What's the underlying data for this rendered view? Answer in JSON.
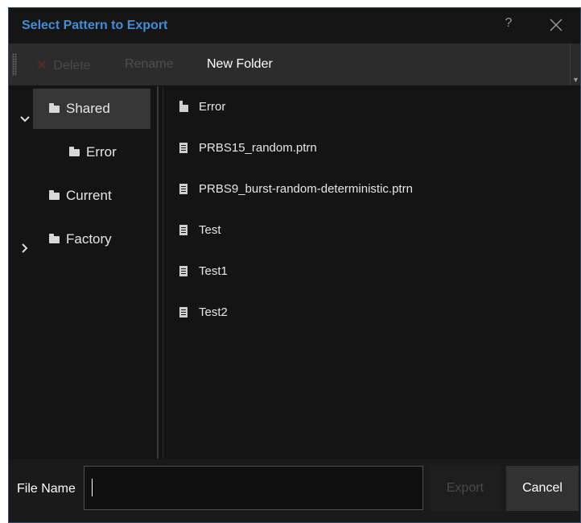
{
  "dialog": {
    "title": "Select Pattern to Export",
    "help_label": "?",
    "close_icon": "close-icon"
  },
  "toolbar": {
    "delete_label": "Delete",
    "rename_label": "Rename",
    "new_folder_label": "New Folder"
  },
  "tree": {
    "items": [
      {
        "label": "Shared",
        "expanded": true,
        "selected": true
      },
      {
        "label": "Error",
        "child_of": "Shared"
      },
      {
        "label": "Current"
      },
      {
        "label": "Factory",
        "expanded": false
      }
    ]
  },
  "files": [
    {
      "name": "Error",
      "type": "folder"
    },
    {
      "name": "PRBS15_random.ptrn",
      "type": "file"
    },
    {
      "name": "PRBS9_burst-random-deterministic.ptrn",
      "type": "file"
    },
    {
      "name": "Test",
      "type": "file"
    },
    {
      "name": "Test1",
      "type": "file"
    },
    {
      "name": "Test2",
      "type": "file"
    }
  ],
  "footer": {
    "file_name_label": "File Name",
    "file_name_value": "",
    "export_label": "Export",
    "cancel_label": "Cancel"
  },
  "colors": {
    "title_accent": "#3f8ed8",
    "background": "#141414",
    "toolbar": "#2c2c2c",
    "selection": "#363636"
  }
}
